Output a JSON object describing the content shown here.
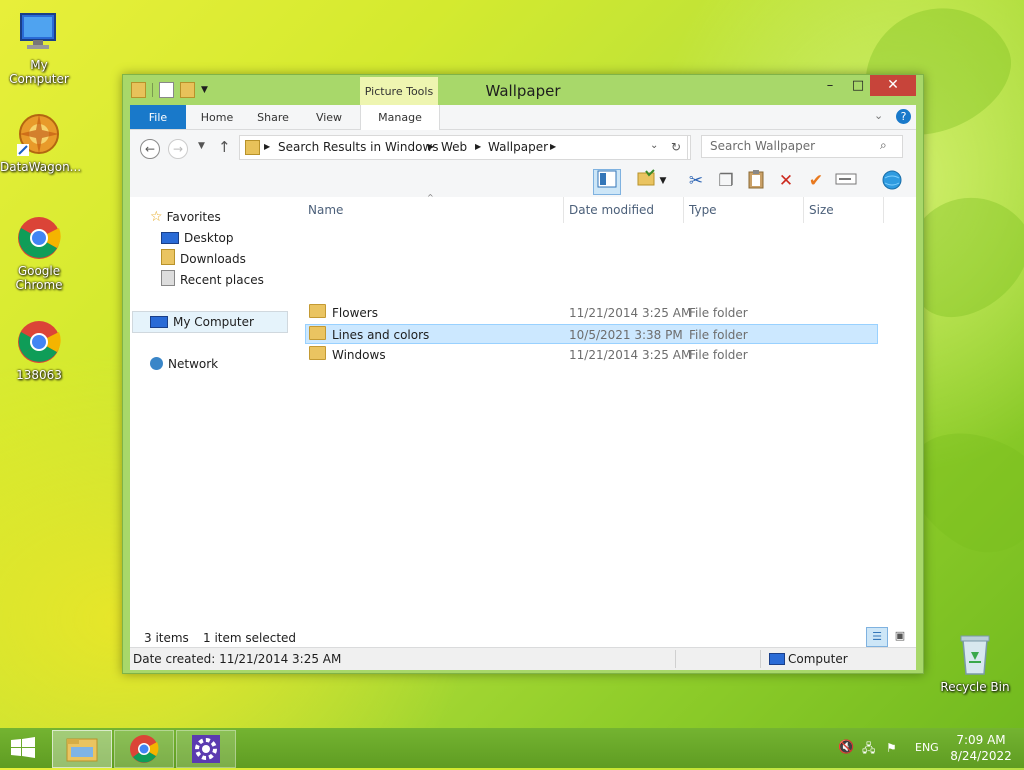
{
  "desktop": {
    "icons": [
      {
        "label": "My Computer",
        "icon": "computer-icon"
      },
      {
        "label": "DataWagon...",
        "icon": "datawagon-icon"
      },
      {
        "label": "Google Chrome",
        "icon": "chrome-icon"
      },
      {
        "label": "138063",
        "icon": "chrome-icon"
      },
      {
        "label": "Recycle Bin",
        "icon": "recycle-bin-icon"
      }
    ]
  },
  "window": {
    "title": "Wallpaper",
    "context_tab_label": "Picture Tools",
    "ribbon_tabs": [
      "File",
      "Home",
      "Share",
      "View",
      "Manage"
    ],
    "breadcrumb": [
      "Search Results in Windows",
      "Web",
      "Wallpaper"
    ],
    "search_placeholder": "Search Wallpaper",
    "nav": {
      "favorites_label": "Favorites",
      "favorites": [
        "Desktop",
        "Downloads",
        "Recent places"
      ],
      "computer_label": "My Computer",
      "network_label": "Network"
    },
    "columns": [
      "Name",
      "Date modified",
      "Type",
      "Size"
    ],
    "files": [
      {
        "name": "Flowers",
        "date": "11/21/2014 3:25 AM",
        "type": "File folder",
        "size": ""
      },
      {
        "name": "Lines and colors",
        "date": "10/5/2021 3:38 PM",
        "type": "File folder",
        "size": ""
      },
      {
        "name": "Windows",
        "date": "11/21/2014 3:25 AM",
        "type": "File folder",
        "size": ""
      }
    ],
    "status": {
      "items": "3 items",
      "selected": "1 item selected"
    },
    "details": {
      "date_created": "Date created: 11/21/2014 3:25 AM",
      "location": "Computer"
    }
  },
  "taskbar": {
    "language": "ENG",
    "time": "7:09 AM",
    "date": "8/24/2022"
  },
  "colors": {
    "ribbon_file_tab": "#1979ca",
    "selection": "#cce8ff",
    "close_button": "#c7443a",
    "window_frame": "#a8d86a"
  }
}
